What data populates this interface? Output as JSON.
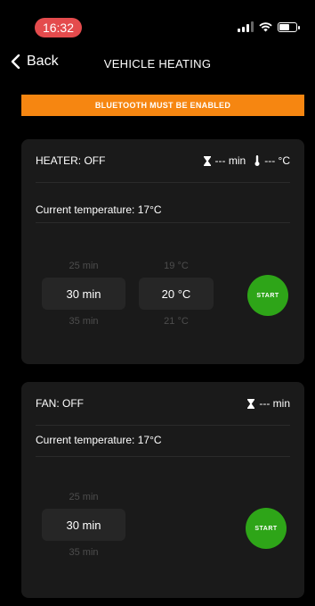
{
  "status": {
    "time": "16:32"
  },
  "nav": {
    "back": "Back",
    "title": "VEHICLE HEATING"
  },
  "banner": "BLUETOOTH MUST BE ENABLED",
  "heater": {
    "title": "HEATER: OFF",
    "timer": "--- min",
    "temp": "--- °C",
    "current": "Current temperature: 17°C",
    "duration": {
      "prev": "25 min",
      "selected": "30 min",
      "next": "35 min"
    },
    "temperature": {
      "prev": "19 °C",
      "selected": "20 °C",
      "next": "21 °C"
    },
    "start": "START"
  },
  "fan": {
    "title": "FAN: OFF",
    "timer": "--- min",
    "current": "Current temperature: 17°C",
    "duration": {
      "prev": "25 min",
      "selected": "30 min",
      "next": "35 min"
    },
    "start": "START"
  },
  "colors": {
    "banner": "#f68611",
    "start": "#2ea518",
    "time_pill": "#e44b4d"
  }
}
